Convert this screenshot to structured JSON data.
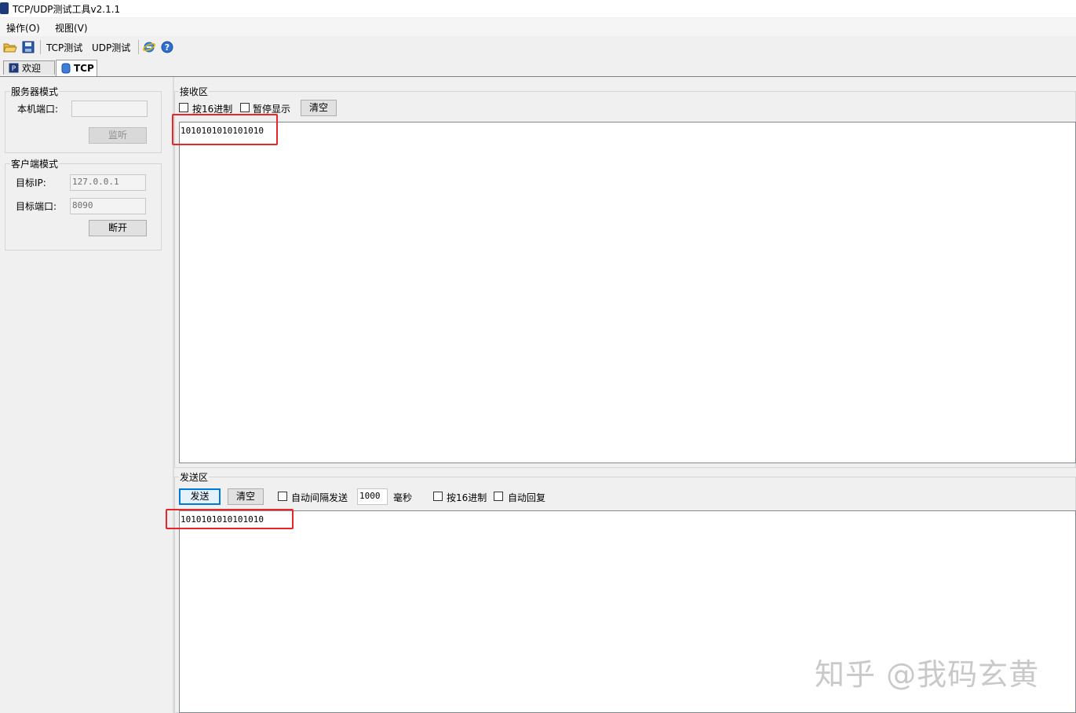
{
  "window": {
    "title": "TCP/UDP测试工具v2.1.1"
  },
  "menu": {
    "items": [
      "操作(O)",
      "视图(V)"
    ]
  },
  "toolbar": {
    "tcp_label": "TCP测试",
    "udp_label": "UDP测试",
    "icons": [
      "open-folder-icon",
      "save-icon",
      "ie-icon",
      "help-icon"
    ]
  },
  "tabs": [
    {
      "label": "欢迎",
      "active": false
    },
    {
      "label": "TCP",
      "active": true
    }
  ],
  "server": {
    "group_title": "服务器模式",
    "port_label": "本机端口:",
    "port_value": "",
    "listen_label": "监听"
  },
  "client": {
    "group_title": "客户端模式",
    "ip_label": "目标IP:",
    "ip_value": "127.0.0.1",
    "port_label": "目标端口:",
    "port_value": "8090",
    "disconnect_label": "断开"
  },
  "receive": {
    "group_title": "接收区",
    "hex_label": "按16进制",
    "pause_label": "暂停显示",
    "clear_label": "清空",
    "content": "1010101010101010"
  },
  "send": {
    "group_title": "发送区",
    "send_label": "发送",
    "clear_label": "清空",
    "auto_label": "自动间隔发送",
    "interval_value": "1000",
    "ms_label": "毫秒",
    "hex_label": "按16进制",
    "auto_reply_label": "自动回复",
    "content": "1010101010101010"
  },
  "watermark": "知乎 @我码玄黄",
  "colors": {
    "highlight": "#e8262a",
    "accent": "#0078d7"
  }
}
